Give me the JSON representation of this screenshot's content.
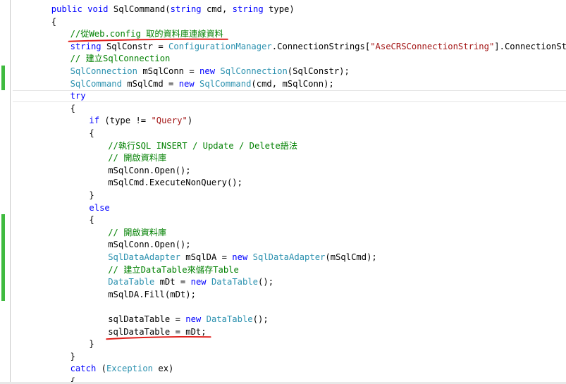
{
  "editor": {
    "language": "csharp",
    "colors": {
      "keyword": "#0000ff",
      "type": "#2b91af",
      "string": "#a31515",
      "comment": "#008000",
      "change_marker": "#3fba3f",
      "annotation_underline": "#e0201c"
    },
    "lines": [
      {
        "indent": 1,
        "tokens": [
          {
            "t": "kw",
            "v": "public"
          },
          {
            "t": "pl",
            "v": " "
          },
          {
            "t": "kw",
            "v": "void"
          },
          {
            "t": "pl",
            "v": " SqlCommand("
          },
          {
            "t": "kw",
            "v": "string"
          },
          {
            "t": "pl",
            "v": " cmd, "
          },
          {
            "t": "kw",
            "v": "string"
          },
          {
            "t": "pl",
            "v": " type)"
          }
        ]
      },
      {
        "indent": 1,
        "tokens": [
          {
            "t": "pl",
            "v": "{"
          }
        ]
      },
      {
        "indent": 2,
        "tokens": [
          {
            "t": "cm",
            "v": "//從Web.config 取的資料庫連線資料"
          }
        ]
      },
      {
        "indent": 2,
        "tokens": [
          {
            "t": "kw",
            "v": "string"
          },
          {
            "t": "pl",
            "v": " SqlConstr = "
          },
          {
            "t": "ty",
            "v": "ConfigurationManager"
          },
          {
            "t": "pl",
            "v": ".ConnectionStrings["
          },
          {
            "t": "str",
            "v": "\"AseCRSConnectionString\""
          },
          {
            "t": "pl",
            "v": "].ConnectionString;"
          }
        ]
      },
      {
        "indent": 2,
        "tokens": [
          {
            "t": "cm",
            "v": "// 建立SqlConnection"
          }
        ]
      },
      {
        "indent": 2,
        "tokens": [
          {
            "t": "ty",
            "v": "SqlConnection"
          },
          {
            "t": "pl",
            "v": " mSqlConn = "
          },
          {
            "t": "kw",
            "v": "new"
          },
          {
            "t": "pl",
            "v": " "
          },
          {
            "t": "ty",
            "v": "SqlConnection"
          },
          {
            "t": "pl",
            "v": "(SqlConstr);"
          }
        ]
      },
      {
        "indent": 2,
        "tokens": [
          {
            "t": "ty",
            "v": "SqlCommand"
          },
          {
            "t": "pl",
            "v": " mSqlCmd = "
          },
          {
            "t": "kw",
            "v": "new"
          },
          {
            "t": "pl",
            "v": " "
          },
          {
            "t": "ty",
            "v": "SqlCommand"
          },
          {
            "t": "pl",
            "v": "(cmd, mSqlConn);"
          }
        ]
      },
      {
        "indent": 2,
        "tokens": [
          {
            "t": "kw",
            "v": "try"
          }
        ]
      },
      {
        "indent": 2,
        "tokens": [
          {
            "t": "pl",
            "v": "{"
          }
        ]
      },
      {
        "indent": 3,
        "tokens": [
          {
            "t": "kw",
            "v": "if"
          },
          {
            "t": "pl",
            "v": " (type != "
          },
          {
            "t": "str",
            "v": "\"Query\""
          },
          {
            "t": "pl",
            "v": ")"
          }
        ]
      },
      {
        "indent": 3,
        "tokens": [
          {
            "t": "pl",
            "v": "{"
          }
        ]
      },
      {
        "indent": 4,
        "tokens": [
          {
            "t": "cm",
            "v": "//執行SQL INSERT / Update / Delete語法"
          }
        ]
      },
      {
        "indent": 4,
        "tokens": [
          {
            "t": "cm",
            "v": "// 開啟資料庫"
          }
        ]
      },
      {
        "indent": 4,
        "tokens": [
          {
            "t": "pl",
            "v": "mSqlConn.Open();"
          }
        ]
      },
      {
        "indent": 4,
        "tokens": [
          {
            "t": "pl",
            "v": "mSqlCmd.ExecuteNonQuery();"
          }
        ]
      },
      {
        "indent": 3,
        "tokens": [
          {
            "t": "pl",
            "v": "}"
          }
        ]
      },
      {
        "indent": 3,
        "tokens": [
          {
            "t": "kw",
            "v": "else"
          }
        ]
      },
      {
        "indent": 3,
        "tokens": [
          {
            "t": "pl",
            "v": "{"
          }
        ]
      },
      {
        "indent": 4,
        "tokens": [
          {
            "t": "cm",
            "v": "// 開啟資料庫"
          }
        ]
      },
      {
        "indent": 4,
        "tokens": [
          {
            "t": "pl",
            "v": "mSqlConn.Open();"
          }
        ]
      },
      {
        "indent": 4,
        "tokens": [
          {
            "t": "ty",
            "v": "SqlDataAdapter"
          },
          {
            "t": "pl",
            "v": " mSqlDA = "
          },
          {
            "t": "kw",
            "v": "new"
          },
          {
            "t": "pl",
            "v": " "
          },
          {
            "t": "ty",
            "v": "SqlDataAdapter"
          },
          {
            "t": "pl",
            "v": "(mSqlCmd);"
          }
        ]
      },
      {
        "indent": 4,
        "tokens": [
          {
            "t": "cm",
            "v": "// 建立DataTable來儲存Table"
          }
        ]
      },
      {
        "indent": 4,
        "tokens": [
          {
            "t": "ty",
            "v": "DataTable"
          },
          {
            "t": "pl",
            "v": " mDt = "
          },
          {
            "t": "kw",
            "v": "new"
          },
          {
            "t": "pl",
            "v": " "
          },
          {
            "t": "ty",
            "v": "DataTable"
          },
          {
            "t": "pl",
            "v": "();"
          }
        ]
      },
      {
        "indent": 4,
        "tokens": [
          {
            "t": "pl",
            "v": "mSqlDA.Fill(mDt);"
          }
        ]
      },
      {
        "indent": 0,
        "tokens": []
      },
      {
        "indent": 4,
        "tokens": [
          {
            "t": "pl",
            "v": "sqlDataTable = "
          },
          {
            "t": "kw",
            "v": "new"
          },
          {
            "t": "pl",
            "v": " "
          },
          {
            "t": "ty",
            "v": "DataTable"
          },
          {
            "t": "pl",
            "v": "();"
          }
        ]
      },
      {
        "indent": 4,
        "tokens": [
          {
            "t": "pl",
            "v": "sqlDataTable = mDt;"
          }
        ]
      },
      {
        "indent": 3,
        "tokens": [
          {
            "t": "pl",
            "v": "}"
          }
        ]
      },
      {
        "indent": 2,
        "tokens": [
          {
            "t": "pl",
            "v": "}"
          }
        ]
      },
      {
        "indent": 2,
        "tokens": [
          {
            "t": "kw",
            "v": "catch"
          },
          {
            "t": "pl",
            "v": " ("
          },
          {
            "t": "ty",
            "v": "Exception"
          },
          {
            "t": "pl",
            "v": " ex)"
          }
        ]
      },
      {
        "indent": 2,
        "tokens": [
          {
            "t": "pl",
            "v": "{"
          }
        ]
      }
    ],
    "changed_lines": [
      5,
      6,
      17,
      18,
      19,
      20,
      21,
      22,
      23
    ],
    "current_line": 7,
    "annotated_lines": [
      2,
      26
    ]
  }
}
